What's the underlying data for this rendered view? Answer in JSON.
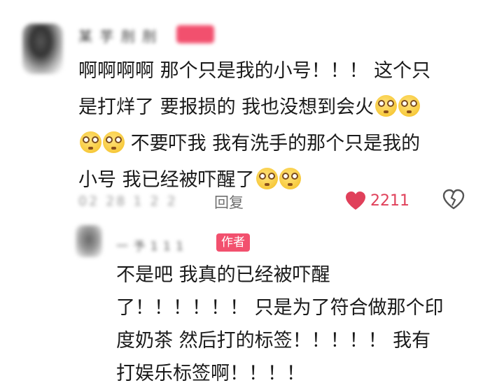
{
  "comment": {
    "username": "某 芋 刖 刖",
    "lines": [
      {
        "text": "啊啊啊啊 那个只是我的小号！！！ 这个只",
        "emojis": 0
      },
      {
        "text": "是打烊了 要报损的 我也没想到会火",
        "emojis": 2
      },
      {
        "text": " 不要吓我 我有洗手的那个只是我的",
        "emojis": 2,
        "emoji_first": true
      },
      {
        "text": "小号 我已经被吓醒了",
        "emojis": 2
      }
    ],
    "date": "02 28 1 2 2",
    "reply_label": "回复",
    "like_count": "2211",
    "emoji_icon": "flushed-face-emoji"
  },
  "reply": {
    "username": "一  予 1 1 1",
    "author_badge": "作者",
    "lines": [
      "不是吧 我真的已经被吓醒",
      "了！！！！！！ 只是为了符合做那个印",
      "度奶茶 然后打的标签！！！！！ 我有",
      "打娱乐标签啊！！！！"
    ]
  },
  "colors": {
    "accent": "#f2506e",
    "like": "#e0405a",
    "muted": "#999999"
  }
}
